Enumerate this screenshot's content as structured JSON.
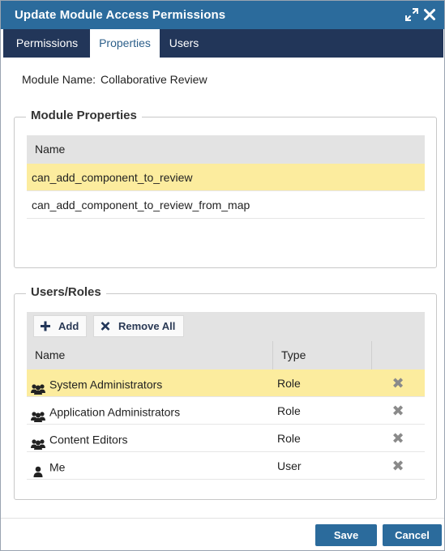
{
  "dialog": {
    "title": "Update Module Access Permissions",
    "icons": {
      "maximize": "expand-arrows-icon",
      "close": "close-x-icon"
    }
  },
  "tabs": [
    {
      "label": "Permissions",
      "active": false
    },
    {
      "label": "Properties",
      "active": true
    },
    {
      "label": "Users",
      "active": false
    }
  ],
  "module": {
    "label": "Module Name:",
    "value": "Collaborative Review"
  },
  "module_properties": {
    "legend": "Module Properties",
    "columns": [
      "Name"
    ],
    "rows": [
      {
        "name": "can_add_component_to_review",
        "selected": true
      },
      {
        "name": "can_add_component_to_review_from_map",
        "selected": false
      }
    ]
  },
  "users_roles": {
    "legend": "Users/Roles",
    "toolbar": {
      "add_label": "Add",
      "remove_all_label": "Remove All"
    },
    "columns": [
      "Name",
      "Type"
    ],
    "rows": [
      {
        "icon": "group-icon",
        "name": "System Administrators",
        "type": "Role",
        "selected": true
      },
      {
        "icon": "group-icon",
        "name": "Application Administrators",
        "type": "Role",
        "selected": false
      },
      {
        "icon": "group-icon",
        "name": "Content Editors",
        "type": "Role",
        "selected": false
      },
      {
        "icon": "user-icon",
        "name": "Me",
        "type": "User",
        "selected": false
      }
    ]
  },
  "footer": {
    "save_label": "Save",
    "cancel_label": "Cancel"
  },
  "colors": {
    "titlebar": "#2b6b9c",
    "tabbar": "#223659",
    "selected_row": "#fcec9e",
    "button": "#2b6b9c"
  }
}
